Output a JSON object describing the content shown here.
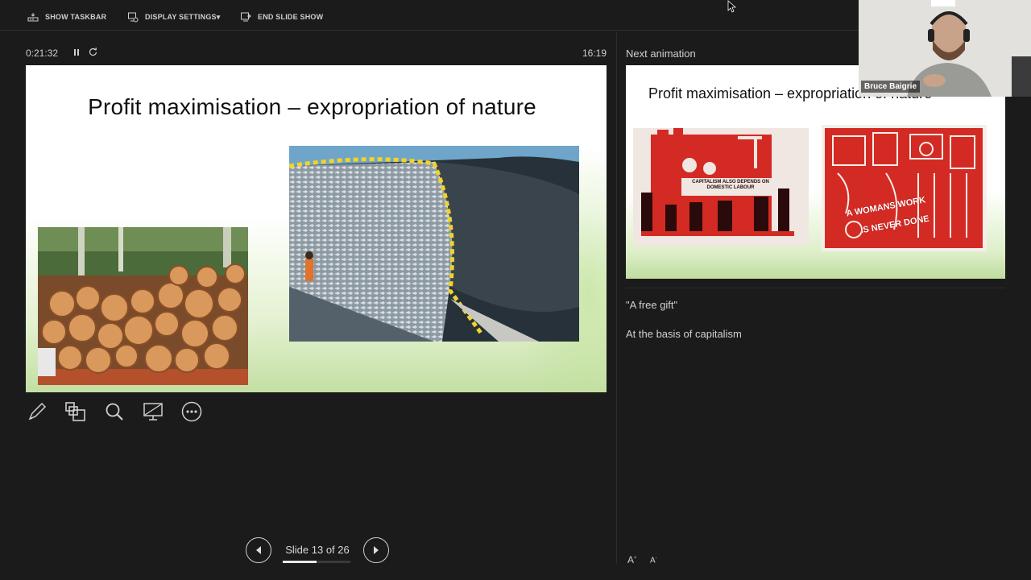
{
  "toolbar": {
    "show_taskbar": "SHOW TASKBAR",
    "display_settings": "DISPLAY SETTINGS",
    "dropdown_caret": "▾",
    "end_slide_show": "END SLIDE SHOW"
  },
  "timer": {
    "elapsed": "0:21:32",
    "pause_icon": "pause-icon",
    "reset_icon": "reset-icon"
  },
  "clock": "16:19",
  "next_label": "Next animation",
  "current_slide": {
    "title": "Profit maximisation – expropriation of nature",
    "images": [
      "log-pile-photo",
      "fishing-net-catch-photo"
    ]
  },
  "next_slide": {
    "title": "Profit maximisation – expropriation of nature",
    "poster1_text": "CAPITALISM ALSO DEPENDS ON DOMESTIC LABOUR",
    "poster2_line1": "A WOMANS WORK",
    "poster2_line2": "IS NEVER DONE"
  },
  "webcam": {
    "name": "Bruce Baigrie"
  },
  "tools": [
    "pen-icon",
    "see-all-slides-icon",
    "zoom-icon",
    "black-screen-icon",
    "more-options-icon"
  ],
  "notes": [
    "\"A free gift\"",
    "At the basis of capitalism"
  ],
  "font_controls": {
    "increase": "A",
    "decrease": "A"
  },
  "navigation": {
    "label": "Slide 13 of 26",
    "current": 13,
    "total": 26,
    "progress": 0.5
  },
  "colors": {
    "background": "#1b1b1b",
    "poster_red": "#d42a24",
    "text": "#d0d0d0"
  }
}
